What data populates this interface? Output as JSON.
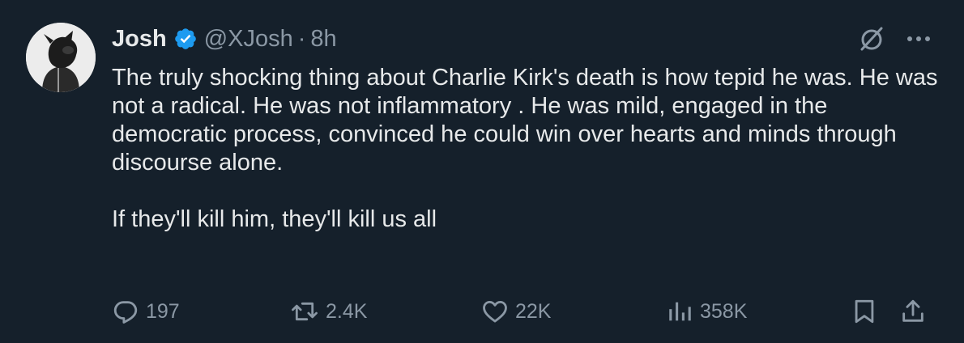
{
  "author": {
    "display_name": "Josh",
    "handle": "@XJosh",
    "separator": "·",
    "time": "8h",
    "verified": true
  },
  "tweet": {
    "paragraphs": [
      "The truly shocking thing about Charlie Kirk's death is how tepid he was. He was not a radical. He was not inflammatory . He was mild, engaged in the democratic process, convinced he could win over hearts and minds through discourse alone.",
      "If they'll kill him, they'll kill us all"
    ]
  },
  "actions": {
    "replies": "197",
    "reposts": "2.4K",
    "likes": "22K",
    "views": "358K"
  },
  "icons": {
    "avatar": "avatar-image",
    "verified": "verified-badge-icon",
    "grok": "grok-icon",
    "more": "more-icon",
    "reply": "reply-icon",
    "repost": "repost-icon",
    "like": "heart-icon",
    "views": "views-icon",
    "bookmark": "bookmark-icon",
    "share": "share-icon"
  },
  "colors": {
    "background": "#15202b",
    "text": "#e7e9ea",
    "secondary_text": "#8b98a5",
    "verified_blue": "#1d9bf0"
  }
}
